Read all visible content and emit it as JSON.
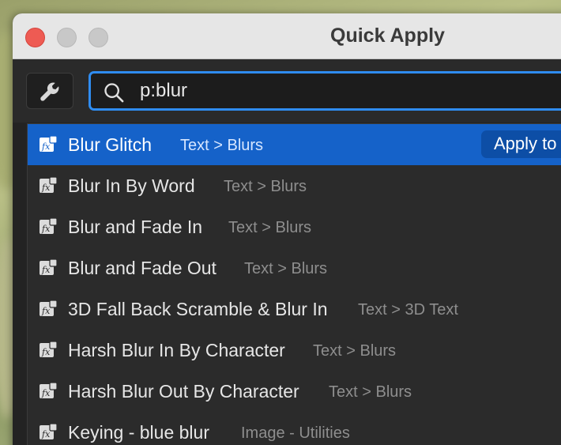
{
  "window": {
    "title": "Quick Apply"
  },
  "search": {
    "value": "p:blur",
    "icon": "search-icon"
  },
  "toolbar": {
    "settings_icon": "wrench-icon"
  },
  "results": [
    {
      "name": "Blur Glitch",
      "path": "Text > Blurs",
      "selected": true
    },
    {
      "name": "Blur In By Word",
      "path": "Text > Blurs",
      "selected": false
    },
    {
      "name": "Blur and Fade In",
      "path": "Text > Blurs",
      "selected": false
    },
    {
      "name": "Blur and Fade Out",
      "path": "Text > Blurs",
      "selected": false
    },
    {
      "name": "3D Fall Back Scramble & Blur In",
      "path": "Text > 3D Text",
      "selected": false
    },
    {
      "name": "Harsh Blur In By Character",
      "path": "Text > Blurs",
      "selected": false
    },
    {
      "name": "Harsh Blur Out By Character",
      "path": "Text > Blurs",
      "selected": false
    },
    {
      "name": "Keying - blue blur",
      "path": "Image - Utilities",
      "selected": false
    }
  ],
  "apply_button": {
    "label": "Apply to"
  },
  "colors": {
    "accent": "#1562c9",
    "focus_ring": "#2f8cf0",
    "close_button": "#ee5b53"
  }
}
